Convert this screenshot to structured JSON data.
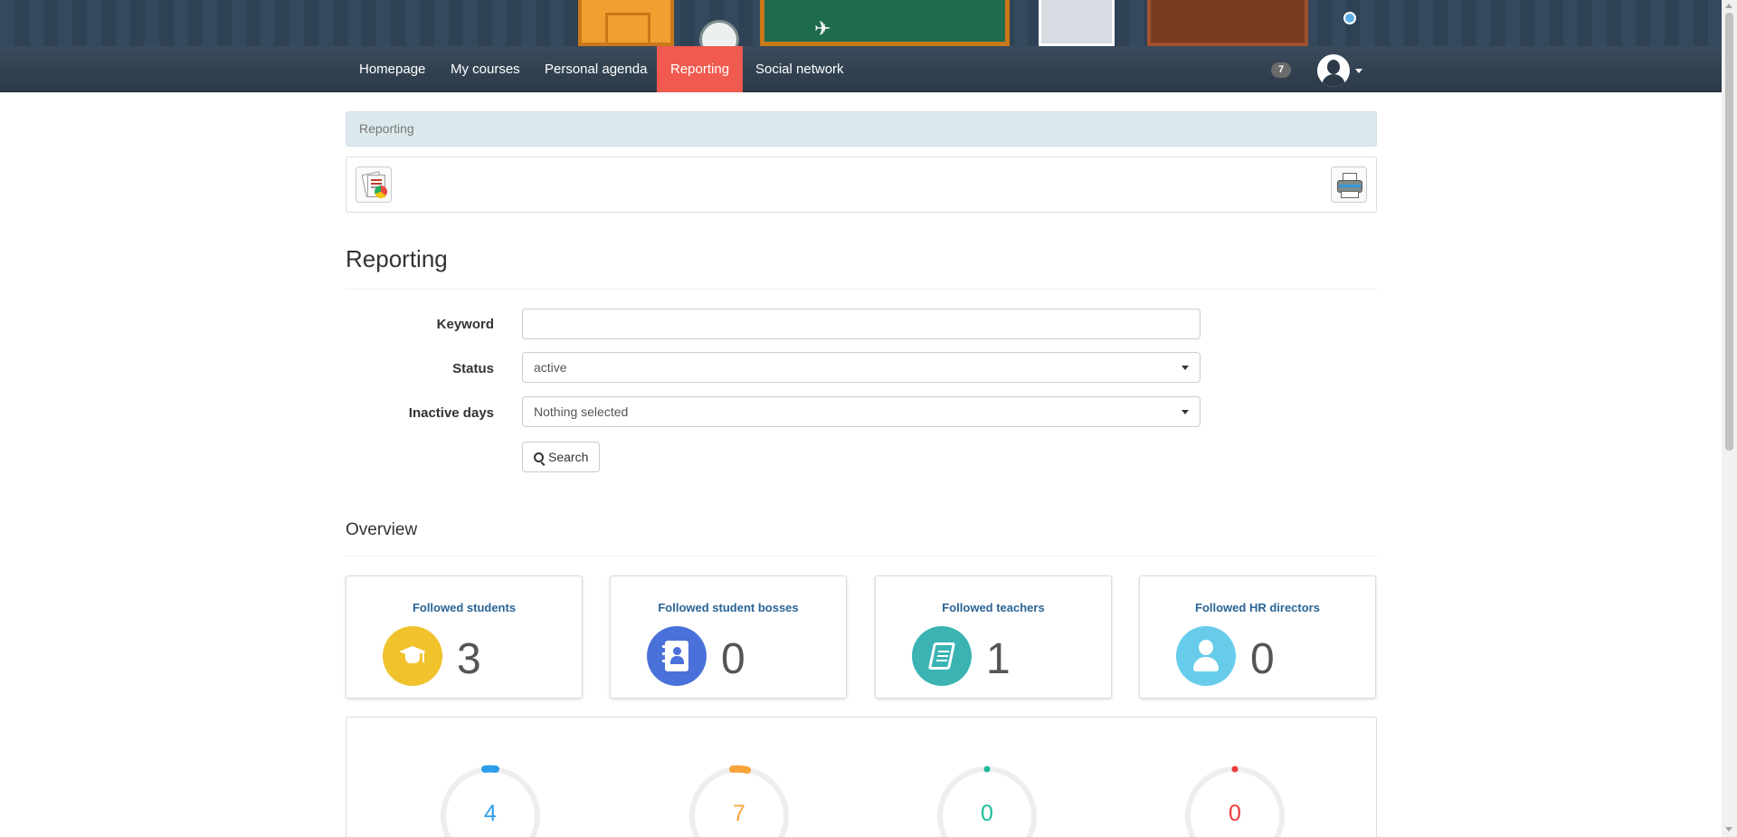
{
  "nav": {
    "items": [
      {
        "label": "Homepage",
        "active": false
      },
      {
        "label": "My courses",
        "active": false
      },
      {
        "label": "Personal agenda",
        "active": false
      },
      {
        "label": "Reporting",
        "active": true
      },
      {
        "label": "Social network",
        "active": false
      }
    ],
    "notification_count": "7",
    "avatar_icon": "user-avatar-icon"
  },
  "breadcrumb": {
    "label": "Reporting"
  },
  "toolbar": {
    "left_icon": "reports-icon",
    "right_icon": "printer-icon"
  },
  "page": {
    "title": "Reporting"
  },
  "form": {
    "keyword": {
      "label": "Keyword",
      "value": "",
      "placeholder": ""
    },
    "status": {
      "label": "Status",
      "value": "active"
    },
    "inactive_days": {
      "label": "Inactive days",
      "value": "Nothing selected"
    },
    "search_label": "Search"
  },
  "overview": {
    "title": "Overview",
    "cards": [
      {
        "title": "Followed students",
        "value": "3",
        "icon": "graduation-cap-icon",
        "color": "#f0c22c"
      },
      {
        "title": "Followed student bosses",
        "value": "0",
        "icon": "contact-book-icon",
        "color": "#4a71d9"
      },
      {
        "title": "Followed teachers",
        "value": "1",
        "icon": "book-icon",
        "color": "#3bb3b3"
      },
      {
        "title": "Followed HR directors",
        "value": "0",
        "icon": "user-icon",
        "color": "#66ccea"
      }
    ],
    "gauges": [
      {
        "value": "4",
        "color": "#2e9ee8"
      },
      {
        "value": "7",
        "color": "#f7a43a"
      },
      {
        "value": "0",
        "color": "#1bbc9b"
      },
      {
        "value": "0",
        "color": "#ee3b3b"
      }
    ]
  }
}
